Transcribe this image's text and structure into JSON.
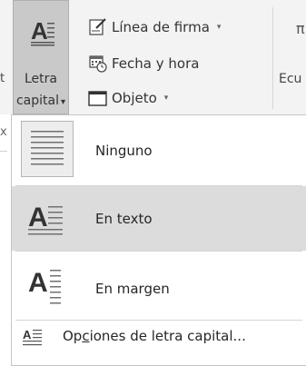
{
  "ribbon": {
    "left_fragment": "t",
    "dropcap_button": {
      "line1": "Letra",
      "line2": "capital",
      "caret": "▾"
    },
    "signature_line": {
      "label": "Línea de firma",
      "caret": "▾",
      "icon": "signature-icon"
    },
    "date_time": {
      "label": "Fecha y hora",
      "icon": "calendar-clock-icon"
    },
    "object": {
      "label": "Objeto",
      "caret": "▾",
      "icon": "object-icon"
    },
    "right_fragment": "Ecu",
    "below_fragment": "x"
  },
  "dropcap_menu": {
    "items": [
      {
        "label": "Ninguno",
        "icon": "dropcap-none-icon"
      },
      {
        "label": "En texto",
        "icon": "dropcap-in-text-icon",
        "highlighted": true
      },
      {
        "label": "En margen",
        "icon": "dropcap-in-margin-icon"
      }
    ],
    "options": {
      "label_before": "Op",
      "mnemonic": "c",
      "label_after": "iones de letra capital...",
      "icon": "dropcap-options-icon"
    }
  },
  "colors": {
    "ribbon_bg": "#f3f3f3",
    "pressed_button": "#c9c9c9",
    "highlight": "#dcdcdc",
    "menu_border": "#c6c6c6"
  }
}
